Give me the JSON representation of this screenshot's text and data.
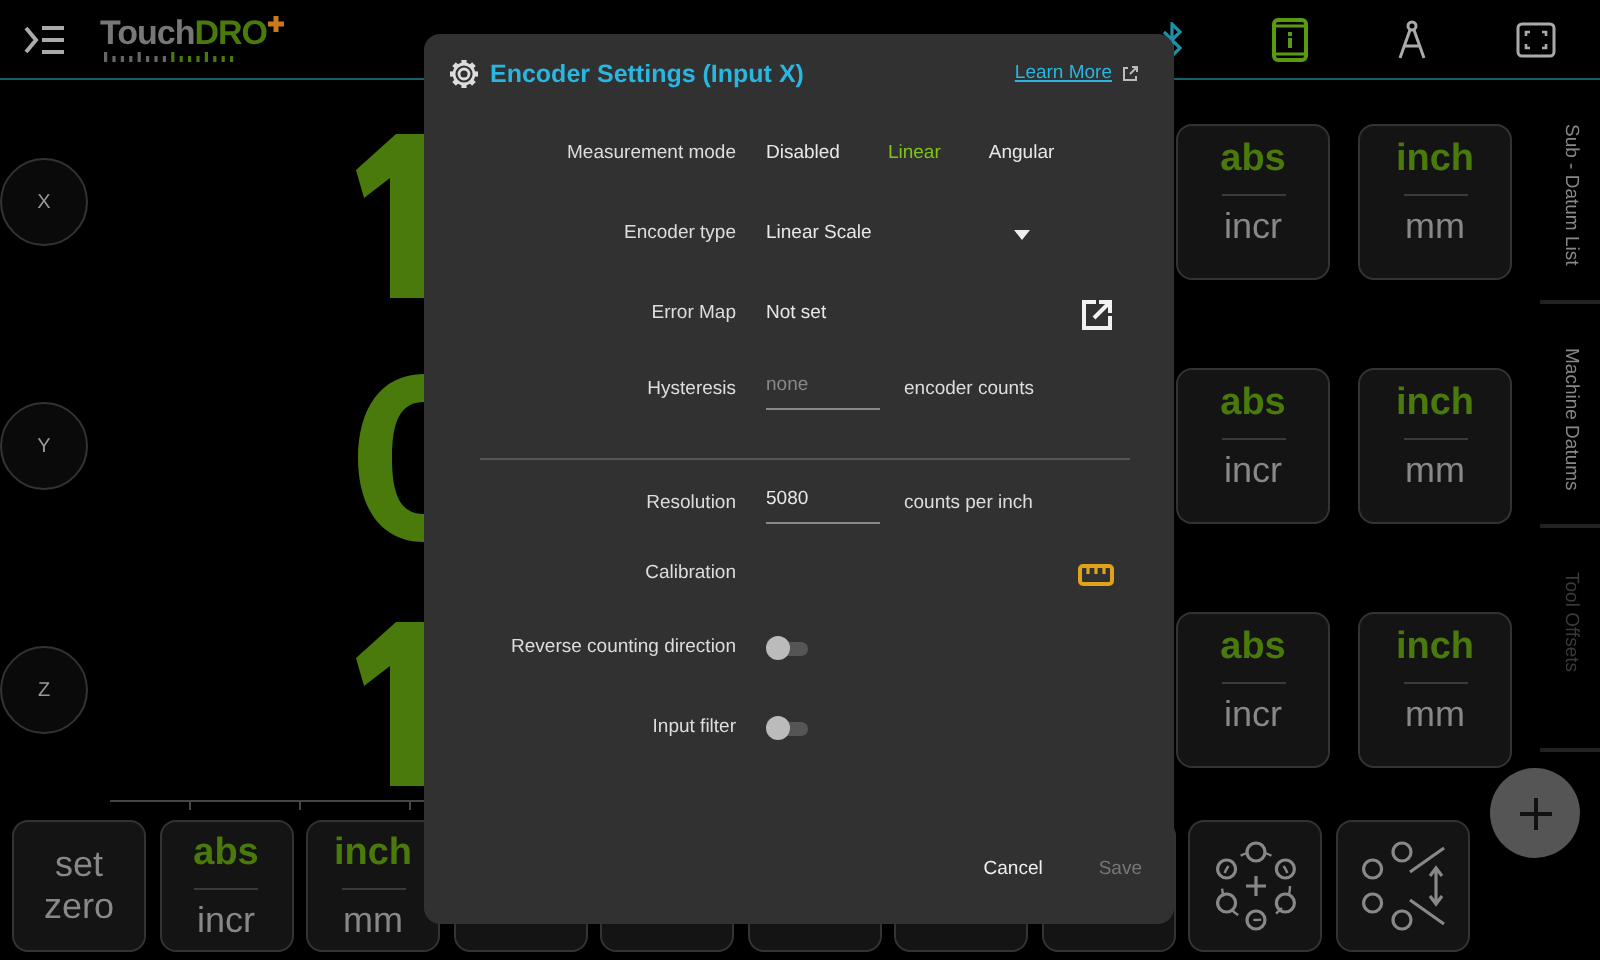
{
  "top_bar": {
    "logo": {
      "prefix": "Touch",
      "accent": "DRO"
    }
  },
  "axes": [
    {
      "label": "X",
      "kind": "stem",
      "mode_toggle": {
        "top": "abs",
        "bottom": "incr"
      },
      "unit_toggle": {
        "top": "inch",
        "bottom": "mm"
      }
    },
    {
      "label": "Y",
      "kind": "arc",
      "mode_toggle": {
        "top": "abs",
        "bottom": "incr"
      },
      "unit_toggle": {
        "top": "inch",
        "bottom": "mm"
      }
    },
    {
      "label": "Z",
      "kind": "stem",
      "mode_toggle": {
        "top": "abs",
        "bottom": "incr"
      },
      "unit_toggle": {
        "top": "inch",
        "bottom": "mm"
      }
    }
  ],
  "side_tabs": [
    {
      "label": "Sub - Datum List",
      "disabled": false
    },
    {
      "label": "Machine Datums",
      "disabled": false
    },
    {
      "label": "Tool Offsets",
      "disabled": true
    }
  ],
  "bottom_bar": [
    {
      "kind": "text",
      "lines": [
        "set",
        "zero"
      ]
    },
    {
      "kind": "toggle",
      "top": "abs",
      "bottom": "incr"
    },
    {
      "kind": "toggle",
      "top": "inch",
      "bottom": "mm"
    },
    {
      "kind": "covered"
    },
    {
      "kind": "covered"
    },
    {
      "kind": "covered"
    },
    {
      "kind": "covered"
    },
    {
      "kind": "covered"
    },
    {
      "kind": "circle_pattern"
    },
    {
      "kind": "circle_rotate"
    }
  ],
  "dialog": {
    "title": "Encoder Settings (Input X)",
    "link": "Learn More",
    "rows": [
      {
        "kind": "segmented",
        "label": "Measurement mode",
        "options": [
          {
            "label": "Disabled",
            "selected": false
          },
          {
            "label": "Linear",
            "selected": true
          },
          {
            "label": "Angular",
            "selected": false
          }
        ]
      },
      {
        "kind": "dropdown",
        "label": "Encoder type",
        "value": "Linear Scale"
      },
      {
        "kind": "action",
        "label": "Error Map",
        "value": "Not set"
      },
      {
        "kind": "input",
        "label": "Hysteresis",
        "placeholder": "none",
        "unit": "encoder counts"
      },
      {
        "kind": "divider"
      },
      {
        "kind": "input",
        "label": "Resolution",
        "value": "5080",
        "unit": "counts per inch"
      },
      {
        "kind": "calibrate",
        "label": "Calibration"
      },
      {
        "kind": "switch",
        "label": "Reverse counting direction",
        "on": false
      },
      {
        "kind": "switch",
        "label": "Input filter",
        "on": false
      }
    ],
    "buttons": [
      {
        "label": "Cancel",
        "disabled": false
      },
      {
        "label": "Save",
        "disabled": true
      }
    ]
  }
}
